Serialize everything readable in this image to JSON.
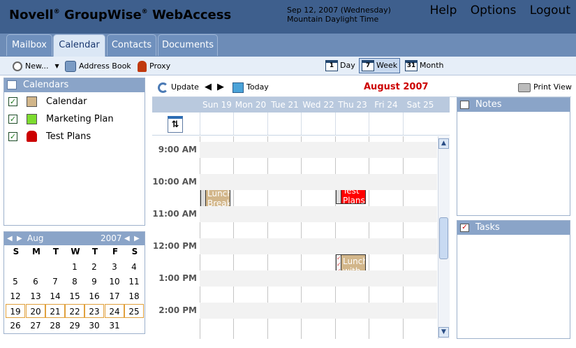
{
  "header": {
    "brand": "Novell",
    "brand_mid": "GroupWise",
    "brand_end": "WebAccess",
    "reg": "®",
    "date_line1": "Sep 12, 2007 (Wednesday)",
    "date_line2": "Mountain Daylight Time",
    "links": [
      "Help",
      "Options",
      "Logout"
    ]
  },
  "tabs": [
    "Mailbox",
    "Calendar",
    "Contacts",
    "Documents"
  ],
  "toolbar": {
    "new_label": "New...",
    "address_book": "Address Book",
    "proxy": "Proxy",
    "views": [
      {
        "label": "Day",
        "num": "1"
      },
      {
        "label": "Week",
        "num": "7"
      },
      {
        "label": "Month",
        "num": "31"
      }
    ]
  },
  "calendars": {
    "title": "Calendars",
    "items": [
      {
        "label": "Calendar",
        "color": "#d2b68a"
      },
      {
        "label": "Marketing Plan",
        "color": "#7ddc2f"
      },
      {
        "label": "Test Plans",
        "color": "#cc0000"
      }
    ]
  },
  "minical": {
    "month": "Aug",
    "year": "2007",
    "dow": [
      "S",
      "M",
      "T",
      "W",
      "T",
      "F",
      "S"
    ],
    "weeks": [
      [
        "",
        "",
        "",
        "1",
        "2",
        "3",
        "4"
      ],
      [
        "5",
        "6",
        "7",
        "8",
        "9",
        "10",
        "11"
      ],
      [
        "12",
        "13",
        "14",
        "15",
        "16",
        "17",
        "18"
      ],
      [
        "19",
        "20",
        "21",
        "22",
        "23",
        "24",
        "25"
      ],
      [
        "26",
        "27",
        "28",
        "29",
        "30",
        "31",
        ""
      ]
    ]
  },
  "calbar": {
    "update": "Update",
    "today": "Today",
    "month_title": "August 2007",
    "print": "Print View"
  },
  "days": [
    "Sun 19",
    "Mon 20",
    "Tue 21",
    "Wed 22",
    "Thu 23",
    "Fri 24",
    "Sat 25"
  ],
  "hours": [
    "9:00 AM",
    "10:00 AM",
    "11:00 AM",
    "12:00 PM",
    "1:00 PM",
    "2:00 PM"
  ],
  "appointments": [
    {
      "text": "Lunch Break",
      "color": "#d2b68a"
    },
    {
      "text": "Review Test Plans",
      "color": "#ff0000"
    },
    {
      "text": "Lunch with Jim",
      "color": "#d2b68a"
    }
  ],
  "notes": {
    "title": "Notes"
  },
  "tasks": {
    "title": "Tasks"
  },
  "colors": {
    "header_bg": "#3e5f8d",
    "accent_red": "#cc0000"
  }
}
